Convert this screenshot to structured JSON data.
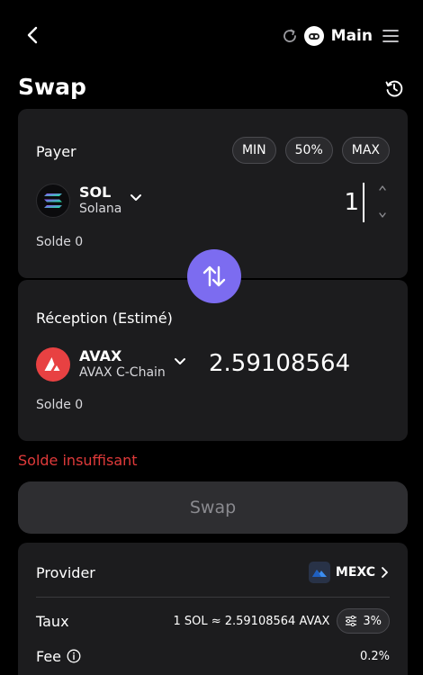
{
  "header": {
    "wallet_name": "Main",
    "icons": [
      "back-arrow",
      "refresh",
      "wallet-avatar",
      "menu"
    ]
  },
  "page": {
    "title": "Swap"
  },
  "pay": {
    "label": "Payer",
    "buttons": {
      "min": "MIN",
      "half": "50%",
      "max": "MAX"
    },
    "token_symbol": "SOL",
    "token_chain": "Solana",
    "amount": "1",
    "balance": "Solde 0"
  },
  "receive": {
    "label": "Réception (Estimé)",
    "token_symbol": "AVAX",
    "token_chain": "AVAX C-Chain",
    "amount": "2.59108564",
    "balance": "Solde 0"
  },
  "error": "Solde insuffisant",
  "swap_button": "Swap",
  "details": {
    "provider_label": "Provider",
    "provider_name": "MEXC",
    "rate_label": "Taux",
    "rate_value": "1 SOL ≈ 2.59108564 AVAX",
    "slippage": "3%",
    "fee_label": "Fee",
    "fee_value": "0.2%"
  },
  "colors": {
    "background": "#000000",
    "card": "#1c1c1e",
    "accent": "#7c6cf0",
    "error": "#e03a3a",
    "avax": "#e84142"
  }
}
